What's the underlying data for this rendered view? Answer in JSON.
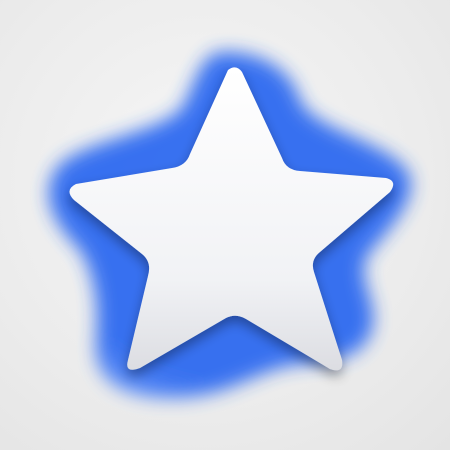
{
  "icon": {
    "name": "star-icon",
    "glow_color": "#2f6bf0",
    "glow_color_light": "#5a8cf7",
    "star_fill_top": "#ffffff",
    "star_fill_bottom": "#dcdde2",
    "background": "#efefef"
  }
}
